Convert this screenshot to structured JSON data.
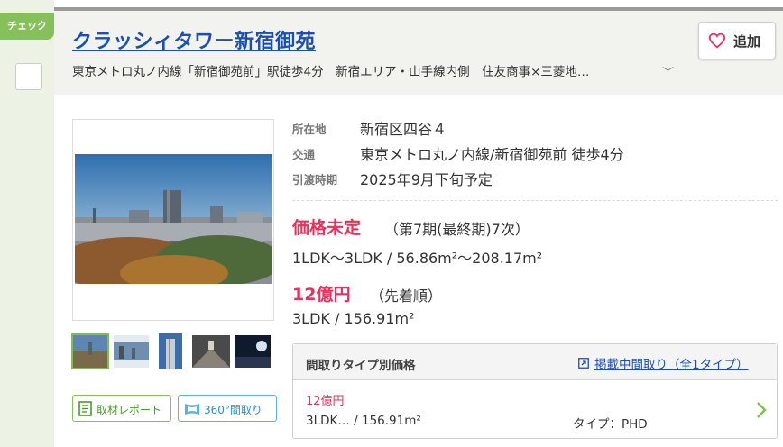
{
  "check": {
    "tab_label": "チェック"
  },
  "header": {
    "title": "クラッシィタワー新宿御苑",
    "subtitle": "東京メトロ丸ノ内線「新宿御苑前」駅徒歩4分　新宿エリア・山手線内側　住友商事×三菱地…",
    "add_label": "追加"
  },
  "info": [
    {
      "key": "所在地",
      "value": "新宿区四谷４"
    },
    {
      "key": "交通",
      "value": "東京メトロ丸ノ内線/新宿御苑前 徒歩4分"
    },
    {
      "key": "引渡時期",
      "value": "2025年9月下旬予定"
    }
  ],
  "offers": [
    {
      "price": "価格未定",
      "note": "（第7期(最終期)7次）",
      "layout": "1LDK～3LDK / 56.86m²～208.17m²"
    },
    {
      "price": "12億円",
      "note": "（先着順）",
      "layout": "3LDK / 156.91m²"
    }
  ],
  "buttons": {
    "report": "取材レポート",
    "tour360": "360°間取り"
  },
  "floorplan_table": {
    "heading": "間取りタイプ別価格",
    "link": "掲載中間取り（全1タイプ）",
    "rows": [
      {
        "price": "12億円",
        "layout": "3LDK… / 156.91m²",
        "type": "タイプ：PHD"
      }
    ]
  },
  "colors": {
    "accent_green": "#86c05a",
    "price_red": "#e8305a",
    "link_blue": "#1a4fb4"
  }
}
